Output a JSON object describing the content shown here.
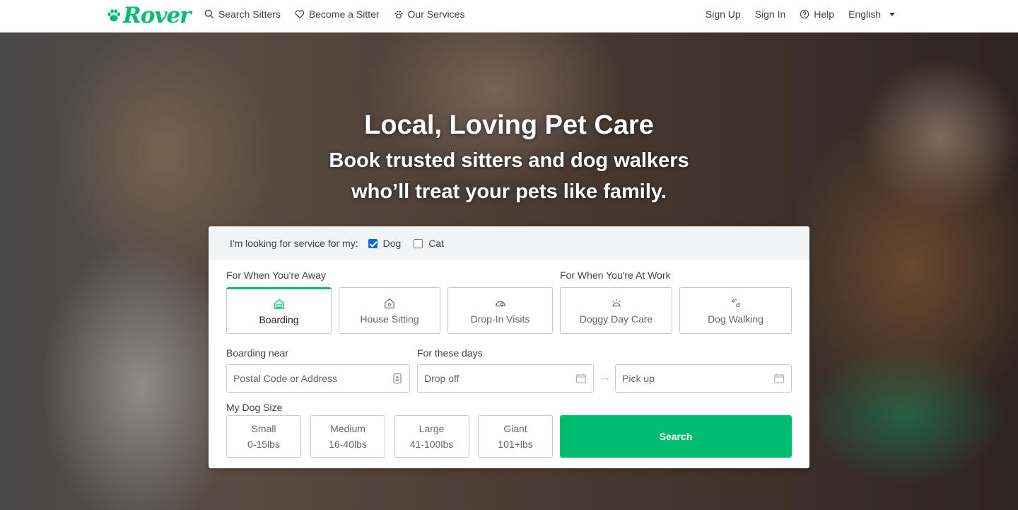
{
  "brand": {
    "name": "Rover",
    "color": "#00bd70"
  },
  "nav": {
    "left": [
      {
        "label": "Search Sitters",
        "icon": "search-icon"
      },
      {
        "label": "Become a Sitter",
        "icon": "heart-icon"
      },
      {
        "label": "Our Services",
        "icon": "paw-icon"
      }
    ],
    "right": {
      "sign_up": "Sign Up",
      "sign_in": "Sign In",
      "help": "Help",
      "language": "English"
    }
  },
  "hero": {
    "title": "Local, Loving Pet Care",
    "subtitle_line1": "Book trusted sitters and dog walkers",
    "subtitle_line2": "who’ll treat your pets like family."
  },
  "search": {
    "pet_question": "I'm looking for service for my:",
    "pets": [
      {
        "label": "Dog",
        "checked": true
      },
      {
        "label": "Cat",
        "checked": false
      }
    ],
    "away_label": "For When You're Away",
    "work_label": "For When You're At Work",
    "services": [
      {
        "label": "Boarding",
        "icon": "boarding-house-icon",
        "active": true
      },
      {
        "label": "House Sitting",
        "icon": "house-sitting-icon",
        "active": false
      },
      {
        "label": "Drop-In Visits",
        "icon": "drop-in-icon",
        "active": false
      },
      {
        "label": "Doggy Day Care",
        "icon": "sun-icon",
        "active": false
      },
      {
        "label": "Dog Walking",
        "icon": "paw-prints-icon",
        "active": false
      }
    ],
    "location_label": "Boarding near",
    "location_placeholder": "Postal Code or Address",
    "dates_label": "For these days",
    "dropoff_placeholder": "Drop off",
    "pickup_placeholder": "Pick up",
    "size_label": "My Dog Size",
    "sizes": [
      {
        "name": "Small",
        "range": "0-15lbs"
      },
      {
        "name": "Medium",
        "range": "16-40lbs"
      },
      {
        "name": "Large",
        "range": "41-100lbs"
      },
      {
        "name": "Giant",
        "range": "101+lbs"
      }
    ],
    "search_button": "Search"
  }
}
